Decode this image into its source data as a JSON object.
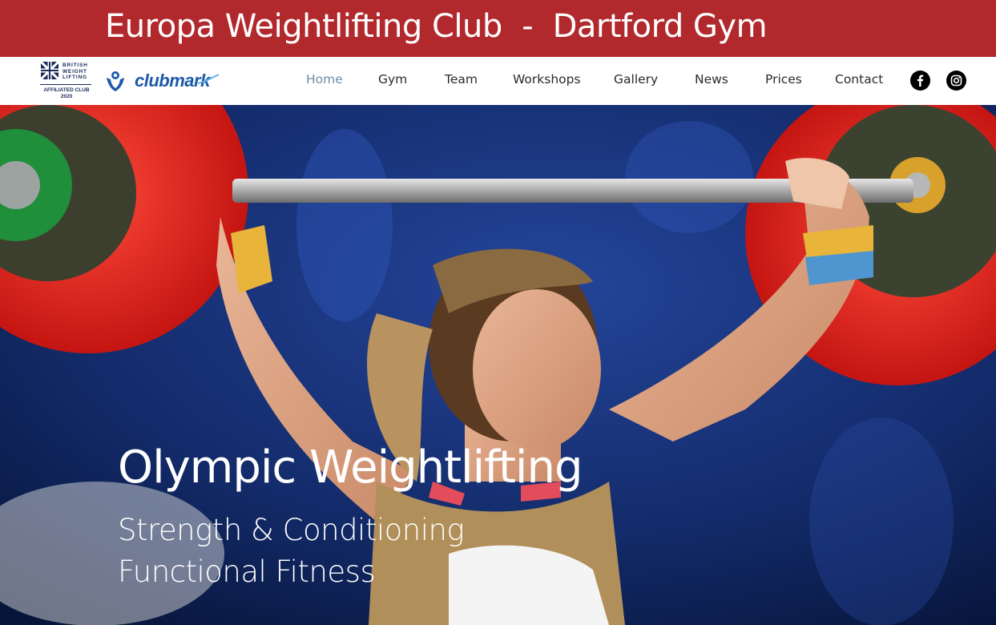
{
  "banner": {
    "title": "Europa Weightlifting Club  -  Dartford Gym"
  },
  "logos": {
    "bwl": {
      "lines": [
        "BRITISH",
        "WEIGHT",
        "LIFTING"
      ],
      "affiliated": "AFFILIATED CLUB",
      "year": "2020"
    },
    "clubmark": "clubmark"
  },
  "nav": {
    "items": [
      {
        "label": "Home",
        "active": true
      },
      {
        "label": "Gym"
      },
      {
        "label": "Team"
      },
      {
        "label": "Workshops"
      },
      {
        "label": "Gallery"
      },
      {
        "label": "News"
      },
      {
        "label": "Prices"
      },
      {
        "label": "Contact"
      }
    ]
  },
  "social": {
    "icons": [
      "facebook-icon",
      "instagram-icon"
    ]
  },
  "hero": {
    "title": "Olympic Weightlifting",
    "line1": "Strength & Conditioning",
    "line2": "Functional Fitness"
  },
  "colors": {
    "banner": "#b1282d",
    "nav_active": "#6b8ea4",
    "nav_text": "#2b2b2b",
    "clubmark_blue": "#1d5aa8",
    "bwl_navy": "#1b2b5a"
  }
}
